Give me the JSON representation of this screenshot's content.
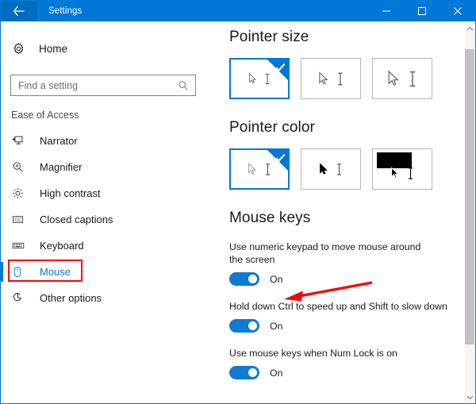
{
  "window": {
    "title": "Settings",
    "back_icon": "back-arrow-icon",
    "controls": [
      {
        "name": "minimize-button",
        "label": "–"
      },
      {
        "name": "maximize-button",
        "label": "□"
      },
      {
        "name": "close-button",
        "label": "✕"
      }
    ],
    "accent_color": "#0078d7",
    "titlebar_color": "#0078d7",
    "back_button_color": "#006cbe"
  },
  "sidebar": {
    "home": {
      "label": "Home",
      "icon": "gear-icon"
    },
    "search": {
      "placeholder": "Find a setting",
      "value": "",
      "icon": "search-icon"
    },
    "section_label": "Ease of Access",
    "items": [
      {
        "label": "Narrator",
        "icon": "narrator-icon",
        "selected": false
      },
      {
        "label": "Magnifier",
        "icon": "magnifier-icon",
        "selected": false
      },
      {
        "label": "High contrast",
        "icon": "high-contrast-icon",
        "selected": false
      },
      {
        "label": "Closed captions",
        "icon": "closed-captions-icon",
        "selected": false
      },
      {
        "label": "Keyboard",
        "icon": "keyboard-icon",
        "selected": false
      },
      {
        "label": "Mouse",
        "icon": "mouse-icon",
        "selected": true
      },
      {
        "label": "Other options",
        "icon": "other-options-icon",
        "selected": false
      }
    ],
    "highlight_color": "#ff0000",
    "selected_text_color": "#0078d7"
  },
  "main": {
    "pointer_size": {
      "heading": "Pointer size",
      "tiles": [
        {
          "name": "pointer-size-small",
          "selected": true,
          "cursor_scale": "small"
        },
        {
          "name": "pointer-size-medium",
          "selected": false,
          "cursor_scale": "medium"
        },
        {
          "name": "pointer-size-large",
          "selected": false,
          "cursor_scale": "large"
        }
      ]
    },
    "pointer_color": {
      "heading": "Pointer color",
      "tiles": [
        {
          "name": "pointer-color-white",
          "selected": true,
          "style": "white"
        },
        {
          "name": "pointer-color-black",
          "selected": false,
          "style": "black"
        },
        {
          "name": "pointer-color-inverted",
          "selected": false,
          "style": "inverted"
        }
      ]
    },
    "mouse_keys": {
      "heading": "Mouse keys",
      "settings": [
        {
          "name": "numeric-keypad-setting",
          "description": "Use numeric keypad to move mouse around the screen",
          "toggle_state": "On",
          "annotated": true
        },
        {
          "name": "ctrl-shift-speed-setting",
          "description": "Hold down Ctrl to speed up and Shift to slow down",
          "toggle_state": "On",
          "annotated": false
        },
        {
          "name": "num-lock-setting",
          "description": "Use mouse keys when Num Lock is on",
          "toggle_state": "On",
          "annotated": false
        }
      ],
      "toggle_on_color": "#0d7bd4"
    }
  },
  "annotation": {
    "arrow_color": "#ff0000",
    "arrow_direction": "left",
    "target": "numeric-keypad-setting-toggle"
  },
  "scrollbar": {
    "up_icon": "chevron-up-icon",
    "down_icon": "chevron-down-icon",
    "thumb_color": "#c2c2c2"
  }
}
